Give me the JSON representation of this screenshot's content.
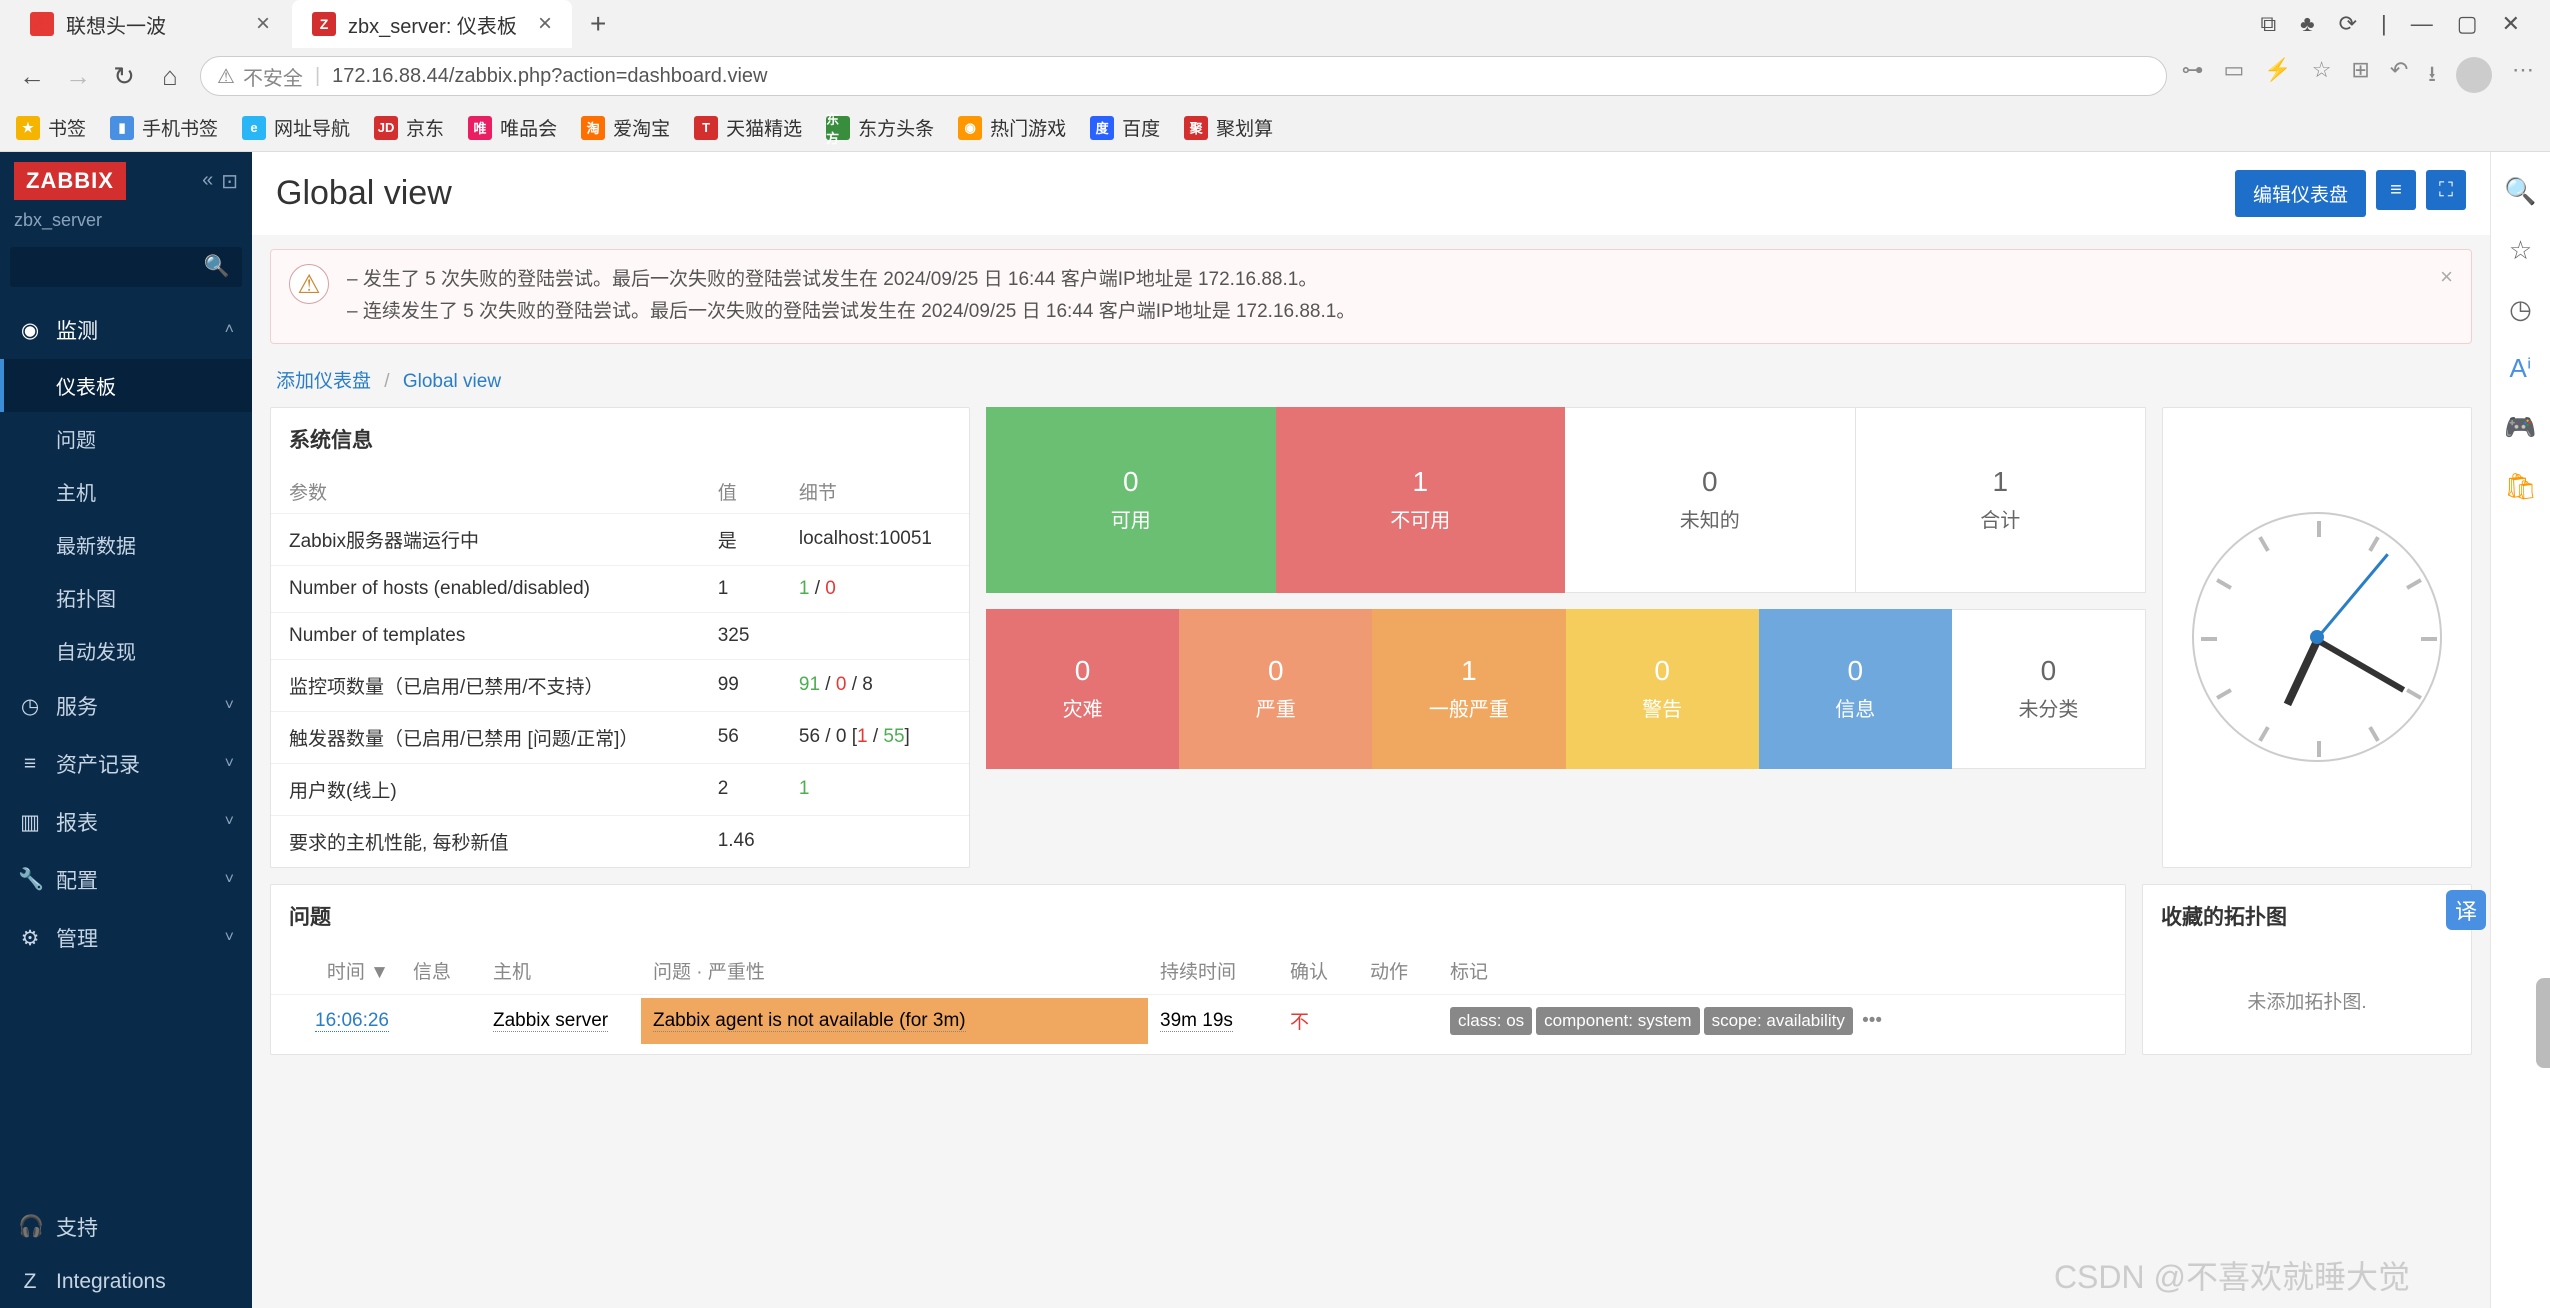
{
  "browser": {
    "tabs": [
      {
        "title": "联想头一波",
        "favicon_bg": "#e53935",
        "favicon_text": "联"
      },
      {
        "title": "zbx_server: 仪表板",
        "favicon_bg": "#d32f2f",
        "favicon_text": "Z"
      }
    ],
    "addr_insecure": "不安全",
    "url": "172.16.88.44/zabbix.php?action=dashboard.view"
  },
  "bookmarks": [
    {
      "label": "书签",
      "icon_bg": "#f5b400",
      "icon_text": "★"
    },
    {
      "label": "手机书签",
      "icon_bg": "#4a90e2",
      "icon_text": "▮"
    },
    {
      "label": "网址导航",
      "icon_bg": "#29b6f6",
      "icon_text": "e"
    },
    {
      "label": "京东",
      "icon_bg": "#d32f2f",
      "icon_text": "JD"
    },
    {
      "label": "唯品会",
      "icon_bg": "#e91e63",
      "icon_text": "唯"
    },
    {
      "label": "爱淘宝",
      "icon_bg": "#ff6f00",
      "icon_text": "淘"
    },
    {
      "label": "天猫精选",
      "icon_bg": "#d32f2f",
      "icon_text": "T"
    },
    {
      "label": "东方头条",
      "icon_bg": "#388e3c",
      "icon_text": "东方"
    },
    {
      "label": "热门游戏",
      "icon_bg": "#ff9800",
      "icon_text": "◉"
    },
    {
      "label": "百度",
      "icon_bg": "#2962ff",
      "icon_text": "度"
    },
    {
      "label": "聚划算",
      "icon_bg": "#d32f2f",
      "icon_text": "聚"
    }
  ],
  "sidebar": {
    "logo": "ZABBIX",
    "server": "zbx_server",
    "sections": {
      "monitoring": {
        "label": "监测",
        "items": [
          "仪表板",
          "问题",
          "主机",
          "最新数据",
          "拓扑图",
          "自动发现"
        ]
      },
      "services": {
        "label": "服务"
      },
      "inventory": {
        "label": "资产记录"
      },
      "reports": {
        "label": "报表"
      },
      "config": {
        "label": "配置"
      },
      "admin": {
        "label": "管理"
      }
    },
    "support": "支持",
    "integrations": "Integrations"
  },
  "page": {
    "title": "Global view",
    "edit_btn": "编辑仪表盘",
    "alerts": [
      "发生了 5 次失败的登陆尝试。最后一次失败的登陆尝试发生在 2024/09/25 日 16:44 客户端IP地址是 172.16.88.1。",
      "连续发生了 5 次失败的登陆尝试。最后一次失败的登陆尝试发生在 2024/09/25 日 16:44 客户端IP地址是 172.16.88.1。"
    ],
    "breadcrumb": {
      "add": "添加仪表盘",
      "current": "Global view"
    }
  },
  "sysinfo": {
    "title": "系统信息",
    "headers": {
      "param": "参数",
      "value": "值",
      "detail": "细节"
    },
    "rows": [
      {
        "param": "Zabbix服务器端运行中",
        "value": "是",
        "value_class": "green",
        "detail": "localhost:10051"
      },
      {
        "param": "Number of hosts (enabled/disabled)",
        "value": "1",
        "detail_html": "<span class='green'>1</span> / <span class='red'>0</span>"
      },
      {
        "param": "Number of templates",
        "value": "325",
        "detail": ""
      },
      {
        "param": "监控项数量（已启用/已禁用/不支持）",
        "value": "99",
        "detail_html": "<span class='green'>91</span> / <span class='red'>0</span> / <span>8</span>"
      },
      {
        "param": "触发器数量（已启用/已禁用 [问题/正常]）",
        "value": "56",
        "detail_html": "56 / 0 [<span class='red'>1</span> / <span class='green'>55</span>]"
      },
      {
        "param": "用户数(线上)",
        "value": "2",
        "detail_html": "<span class='green'>1</span>"
      },
      {
        "param": "要求的主机性能, 每秒新值",
        "value": "1.46",
        "detail": ""
      }
    ]
  },
  "availability": [
    {
      "num": "0",
      "label": "可用",
      "color": "#6bbf73"
    },
    {
      "num": "1",
      "label": "不可用",
      "color": "#e57373"
    },
    {
      "num": "0",
      "label": "未知的",
      "color": "#ffffff",
      "grey": true
    },
    {
      "num": "1",
      "label": "合计",
      "color": "#ffffff",
      "grey": true
    }
  ],
  "severity": [
    {
      "num": "0",
      "label": "灾难",
      "color": "#e57373"
    },
    {
      "num": "0",
      "label": "严重",
      "color": "#ef9a72"
    },
    {
      "num": "1",
      "label": "一般严重",
      "color": "#f0a860"
    },
    {
      "num": "0",
      "label": "警告",
      "color": "#f5cd5d"
    },
    {
      "num": "0",
      "label": "信息",
      "color": "#6fa8dc"
    },
    {
      "num": "0",
      "label": "未分类",
      "color": "#ffffff",
      "grey": true
    }
  ],
  "problems": {
    "title": "问题",
    "headers": {
      "time": "时间 ▼",
      "info": "信息",
      "host": "主机",
      "problem": "问题 · 严重性",
      "duration": "持续时间",
      "ack": "确认",
      "actions": "动作",
      "tags": "标记"
    },
    "rows": [
      {
        "time": "16:06:26",
        "host": "Zabbix server",
        "problem": "Zabbix agent is not available (for 3m)",
        "severity_color": "#f0a860",
        "duration": "39m 19s",
        "ack": "不",
        "tags": [
          "class: os",
          "component: system",
          "scope: availability"
        ]
      }
    ]
  },
  "favmaps": {
    "title": "收藏的拓扑图",
    "empty": "未添加拓扑图."
  },
  "watermark": "CSDN @不喜欢就睡大觉"
}
